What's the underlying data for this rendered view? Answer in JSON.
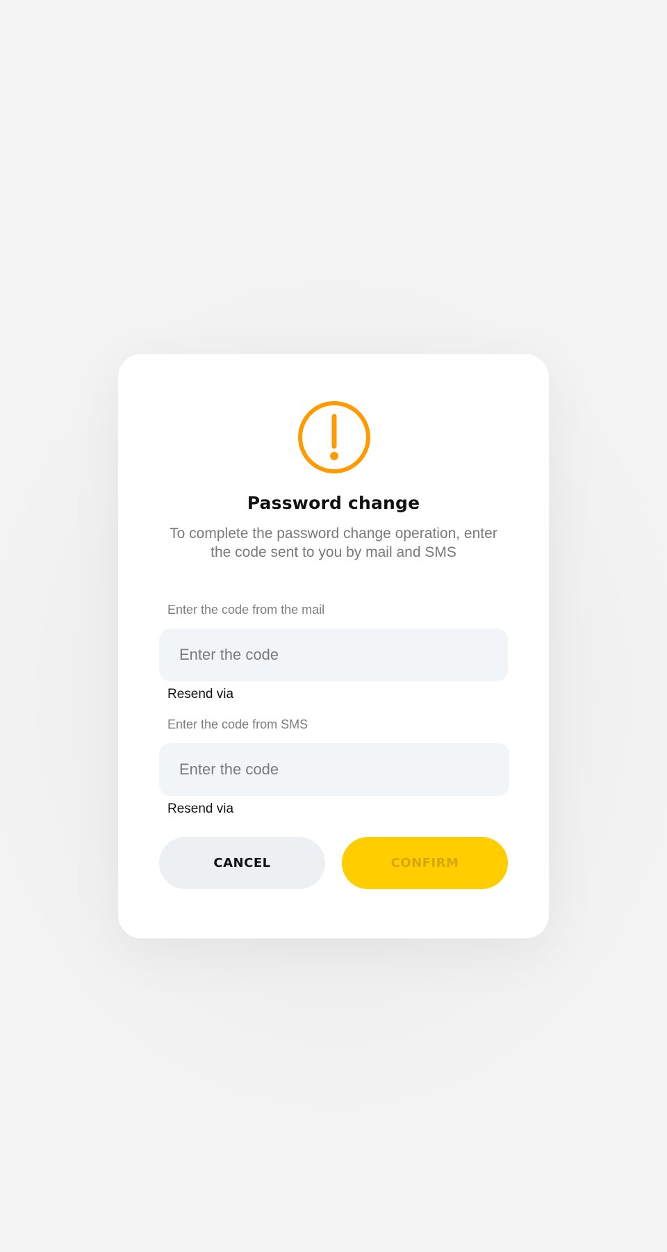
{
  "dialog": {
    "icon": "exclamation-circle-icon",
    "title": "Password change",
    "subtitle": "To complete the password change operation, enter the code sent to you by mail and SMS",
    "mail": {
      "label": "Enter the code from the mail",
      "placeholder": "Enter the code",
      "value": "",
      "resend_label": "Resend via"
    },
    "sms": {
      "label": "Enter the code from SMS",
      "placeholder": "Enter the code",
      "value": "",
      "resend_label": "Resend via"
    },
    "buttons": {
      "cancel_label": "CANCEL",
      "confirm_label": "CONFIRM"
    }
  },
  "colors": {
    "accent_icon": "#ff9a00",
    "confirm_button": "#ffcd00",
    "confirm_text_disabled": "#d8a80a",
    "input_background": "#f2f5f8",
    "cancel_button": "#edf0f3"
  }
}
